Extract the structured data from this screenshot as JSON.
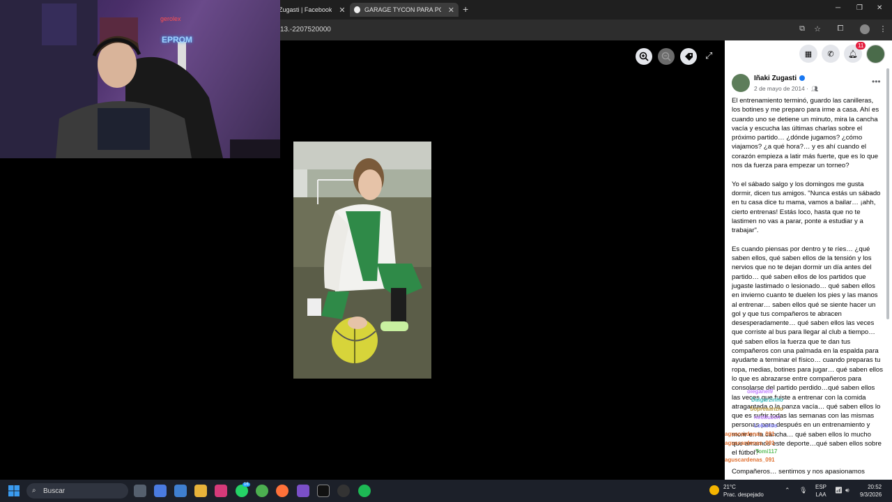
{
  "browser": {
    "tabs": [
      {
        "label": "Zugasti | Facebook"
      },
      {
        "label": "GARAGE TYCON PARA PC - Bus"
      }
    ],
    "new_tab": "+",
    "url": "13.-2207520000",
    "window_controls": [
      "─",
      "❐",
      "✕"
    ]
  },
  "stream_overlay": {
    "label_top": "gerolex",
    "label_neon": "EPROM"
  },
  "viewer": {
    "zoom_in": "⊕",
    "zoom_out": "⊖",
    "tag": "tag-icon",
    "expand": "⤢"
  },
  "facebook_header": {
    "notification_count": "11"
  },
  "post": {
    "author": "Iñaki Zugasti",
    "date": "2 de mayo de 2014 ·",
    "paragraphs": [
      "El entrenamiento terminó, guardo las canilleras, los botines y me preparo para irme a casa. Ahí es cuando uno se detiene un minuto, mira la cancha vacía y escucha las últimas charlas sobre el próximo partido… ¿dónde jugamos? ¿cómo viajamos? ¿a qué hora?… y es ahí cuando el corazón empieza a latir más fuerte, que es lo que nos da fuerza para empezar un torneo?",
      "Yo el sábado salgo y los domingos me gusta dormir, dicen tus amigos. \"Nunca estás un sábado en tu casa dice tu mama, vamos a bailar… ¡ahh, cierto entrenas! Estás loco, hasta que no te lastimen no vas a parar, ponte a estudiar y a trabajar\".",
      "Es cuando piensas por dentro y te ríes… ¿qué saben ellos, qué saben ellos de la tensión y los nervios que no te dejan dormir un día antes del partido… qué saben ellos de los partidos que jugaste lastimado o lesionado… qué saben ellos en invierno cuanto te duelen los pies y las manos al entrenar… saben ellos qué se siente hacer un gol y que tus compañeros te abracen desesperadamente… qué saben ellos las veces que corriste al bus para llegar al club a tiempo… qué saben ellos la fuerza que te dan tus compañeros con una palmada en la espalda para ayudarte a terminar el físico… cuando preparas tu ropa, medias, botines para jugar… qué saben ellos lo que es abrazarse entre compañeros para consolarse del partido perdido…qué saben ellos las veces que fuiste a entrenar con la comida atragantada o la panza vacía… qué saben ellos lo que es sufrir todas las semanas con las mismas personas para después en un entrenamiento y morir en la cancha… qué saben ellos lo mucho que amamos este deporte…qué saben ellos sobre el fútbol?",
      "Compañeros… sentimos y nos apasionamos"
    ]
  },
  "chat_overlay": [
    {
      "user": "oleganel9",
      "color": "#c080ff"
    },
    {
      "user": "Dalgarzinho",
      "color": "#40c0c0"
    },
    {
      "user": "Sopreaanzio",
      "color": "#c0a040"
    },
    {
      "user": "neobuzon",
      "color": "#c080ff"
    },
    {
      "user": "Lokarlos",
      "color": "#8080ff"
    },
    {
      "user": "aguscardenas_091",
      "color": "#e07030"
    },
    {
      "user": "aguscardenas_091",
      "color": "#e07030"
    },
    {
      "user": "Tomi117",
      "color": "#60c060"
    },
    {
      "user": "aguscardenas_091",
      "color": "#e07030"
    }
  ],
  "taskbar": {
    "search_placeholder": "Buscar",
    "weather_temp": "21°C",
    "weather_desc": "Prac. despejado",
    "lang_1": "ESP",
    "lang_2": "LAA",
    "time": "20:52",
    "date": "9/3/2026",
    "app_badge": "16"
  }
}
